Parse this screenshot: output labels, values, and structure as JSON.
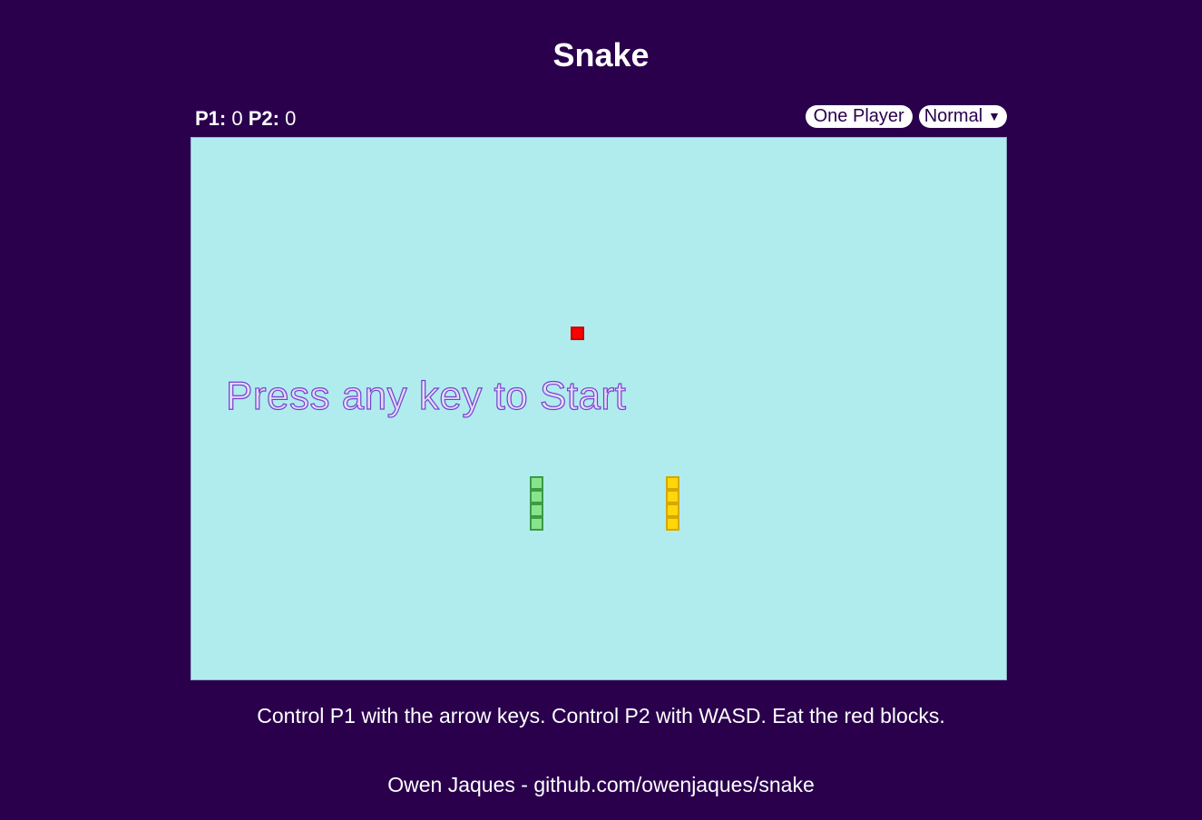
{
  "page": {
    "title": "Snake"
  },
  "scoreboard": {
    "p1_label": "P1:",
    "p1_score": "0",
    "p2_label": "P2:",
    "p2_score": "0"
  },
  "controls": {
    "mode_button_label": "One Player",
    "difficulty_selected": "Normal",
    "difficulty_chevron": "▼"
  },
  "board": {
    "message": "Press any key to Start",
    "colors": {
      "background": "#b0ecee",
      "food": "#ff0000",
      "player1": "#86e48d",
      "player2": "#ffd60a"
    }
  },
  "instructions": "Control P1 with the arrow keys. Control P2 with WASD. Eat the red blocks.",
  "footer": "Owen Jaques - github.com/owenjaques/snake"
}
